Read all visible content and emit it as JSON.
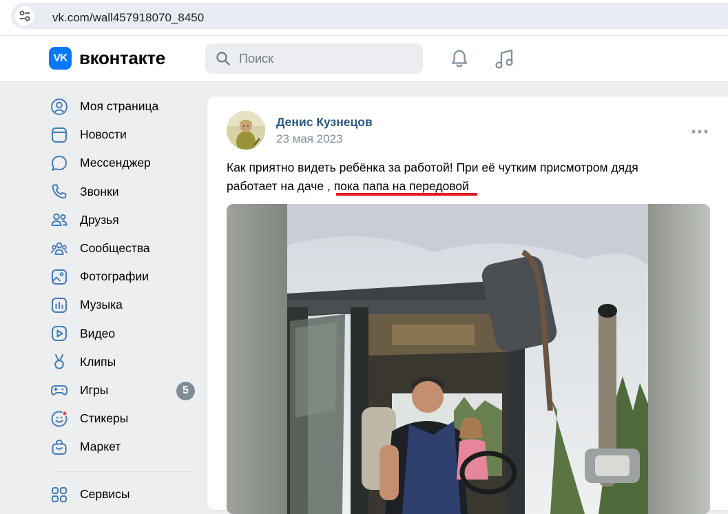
{
  "browser": {
    "url": "vk.com/wall457918070_8450"
  },
  "header": {
    "logo_mark": "VK",
    "logo_text": "вконтакте",
    "search_placeholder": "Поиск"
  },
  "sidebar": {
    "items": [
      {
        "label": "Моя страница",
        "icon": "user-circle-icon"
      },
      {
        "label": "Новости",
        "icon": "newsfeed-icon"
      },
      {
        "label": "Мессенджер",
        "icon": "message-icon"
      },
      {
        "label": "Звонки",
        "icon": "phone-icon"
      },
      {
        "label": "Друзья",
        "icon": "friends-icon"
      },
      {
        "label": "Сообщества",
        "icon": "communities-icon"
      },
      {
        "label": "Фотографии",
        "icon": "photos-icon"
      },
      {
        "label": "Музыка",
        "icon": "music-icon"
      },
      {
        "label": "Видео",
        "icon": "video-icon"
      },
      {
        "label": "Клипы",
        "icon": "clips-icon"
      },
      {
        "label": "Игры",
        "icon": "games-icon",
        "badge": "5"
      },
      {
        "label": "Стикеры",
        "icon": "stickers-icon"
      },
      {
        "label": "Маркет",
        "icon": "market-icon"
      }
    ],
    "services_label": "Сервисы"
  },
  "post": {
    "author": "Денис Кузнецов",
    "date": "23 мая 2023",
    "text_line1": "Как приятно видеть ребёнка за работой! При её чутким присмотром дядя",
    "text_line2_a": "работает на даче ,",
    "text_line2_b": "пока папа на передовой"
  },
  "colors": {
    "accent": "#0077ff",
    "link": "#2a5885",
    "highlight_underline": "#e11b22",
    "page_bg": "#edeef0"
  }
}
